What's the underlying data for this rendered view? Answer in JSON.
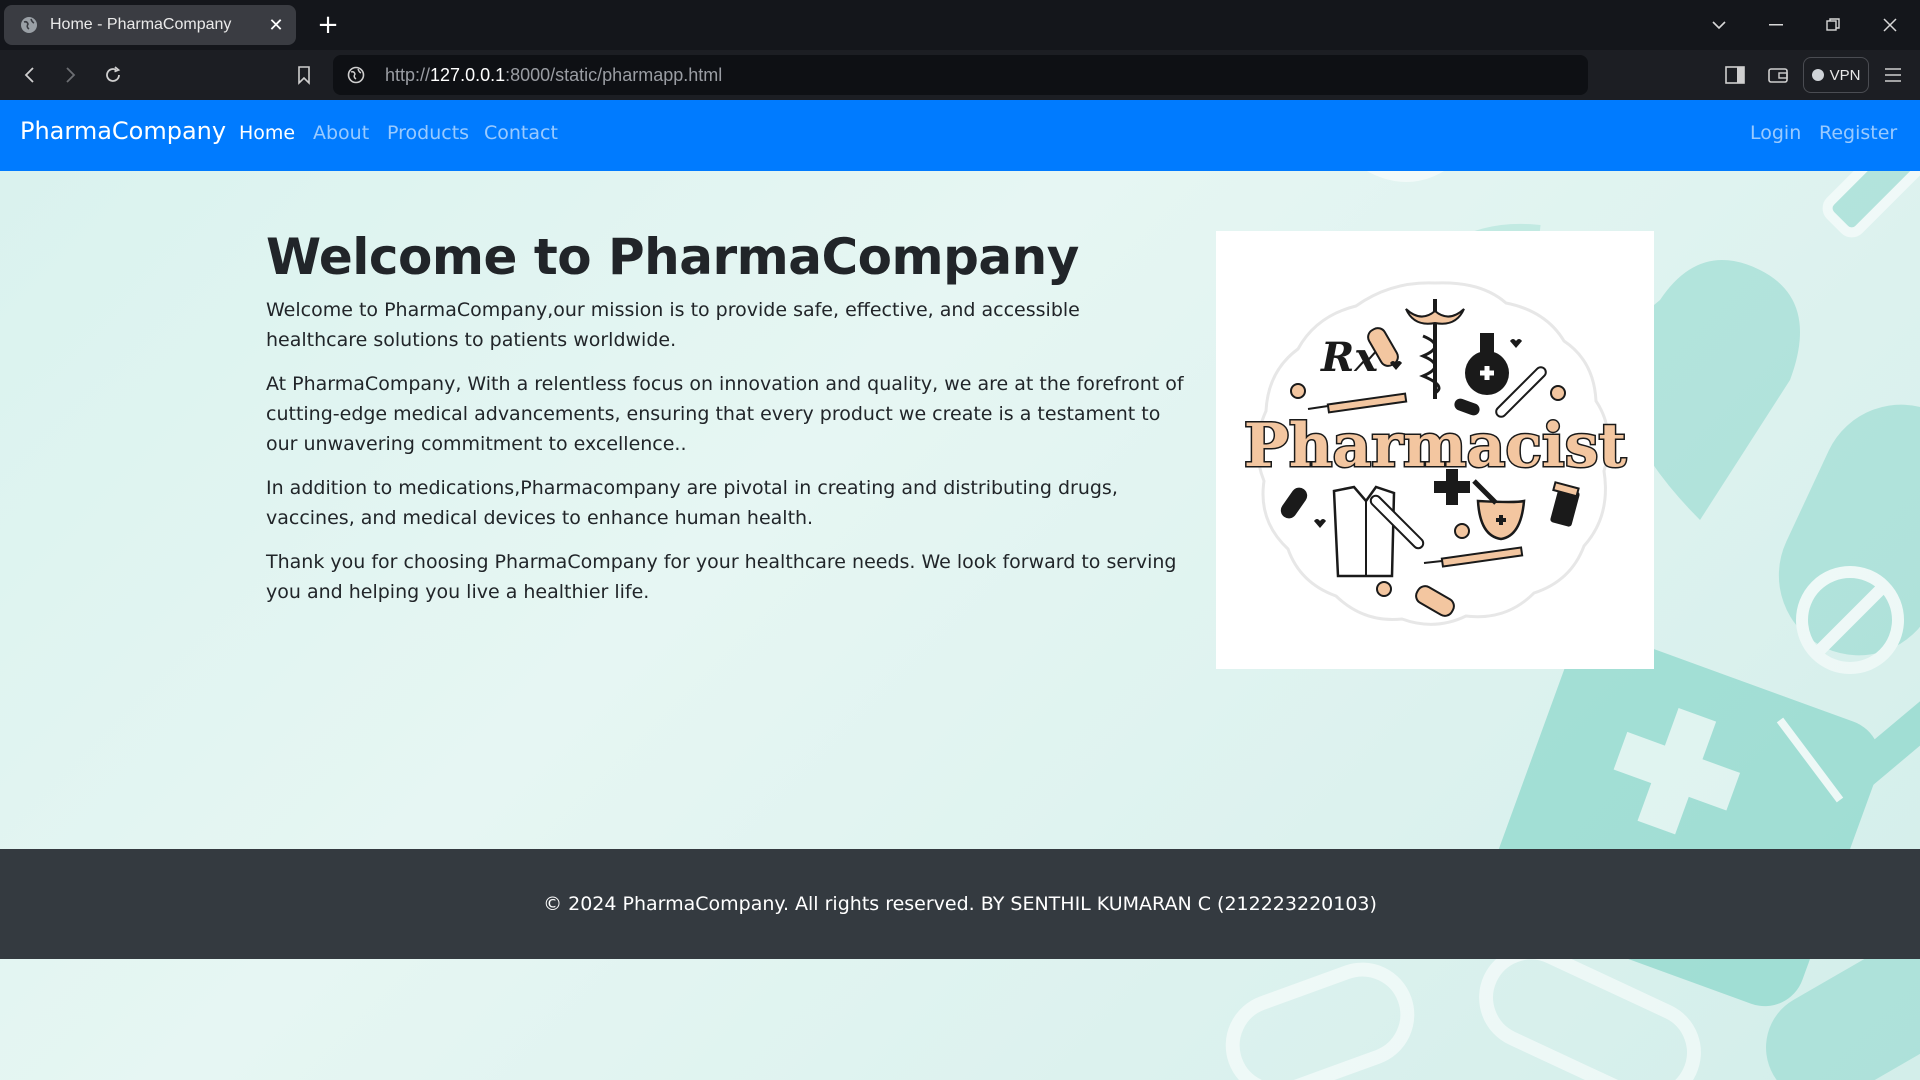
{
  "browser": {
    "tab_title": "Home - PharmaCompany",
    "url_scheme": "http://",
    "url_host": "127.0.0.1",
    "url_rest": ":8000/static/pharmapp.html",
    "vpn_label": "VPN"
  },
  "navbar": {
    "brand": "PharmaCompany",
    "links": [
      "Home",
      "About",
      "Products",
      "Contact"
    ],
    "right_links": [
      "Login",
      "Register"
    ],
    "color": "#007bff"
  },
  "main": {
    "heading": "Welcome to PharmaCompany",
    "paragraphs": [
      "Welcome to PharmaCompany,our mission is to provide safe, effective, and accessible healthcare solutions to patients worldwide.",
      "At PharmaCompany, With a relentless focus on innovation and quality, we are at the forefront of cutting-edge medical advancements, ensuring that every product we create is a testament to our unwavering commitment to excellence..",
      "In addition to medications,Pharmacompany are pivotal in creating and distributing drugs, vaccines, and medical devices to enhance human health.",
      "Thank you for choosing PharmaCompany for your healthcare needs. We look forward to serving you and helping you live a healthier life."
    ],
    "image_text": "Pharmacist",
    "image_rx": "Rx"
  },
  "footer": {
    "text": "© 2024 PharmaCompany. All rights reserved. BY SENTHIL KUMARAN C (212223220103)",
    "color": "#343a40"
  }
}
